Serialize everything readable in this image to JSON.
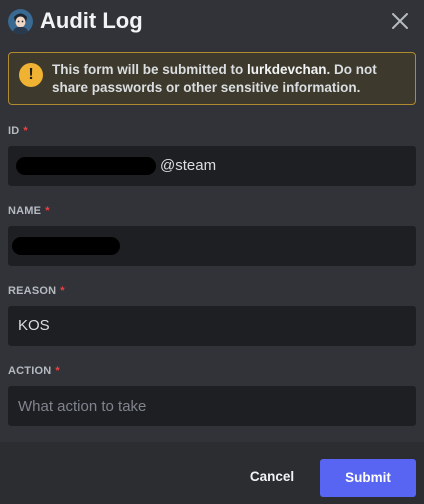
{
  "header": {
    "title": "Audit Log",
    "avatar_icon": "character-avatar-icon",
    "close_icon": "close-icon"
  },
  "warning": {
    "icon": "exclamation-icon",
    "text_before": "This form will be submitted to ",
    "app_name": "lurkdevchan",
    "text_after": ". Do not share passwords or other sensitive information."
  },
  "form": {
    "id": {
      "label": "ID",
      "required_mark": "*",
      "value_suffix": "@steam"
    },
    "name": {
      "label": "NAME",
      "required_mark": "*"
    },
    "reason": {
      "label": "REASON",
      "required_mark": "*",
      "value": "KOS"
    },
    "action": {
      "label": "ACTION",
      "required_mark": "*",
      "placeholder": "What action to take"
    }
  },
  "footer": {
    "cancel_label": "Cancel",
    "submit_label": "Submit"
  },
  "colors": {
    "background": "#313338",
    "input_bg": "#1e1f22",
    "footer_bg": "#2b2d31",
    "warning_border": "#b08a2e",
    "warning_icon": "#f0b232",
    "required": "#f23f43",
    "accent": "#5865f2"
  }
}
